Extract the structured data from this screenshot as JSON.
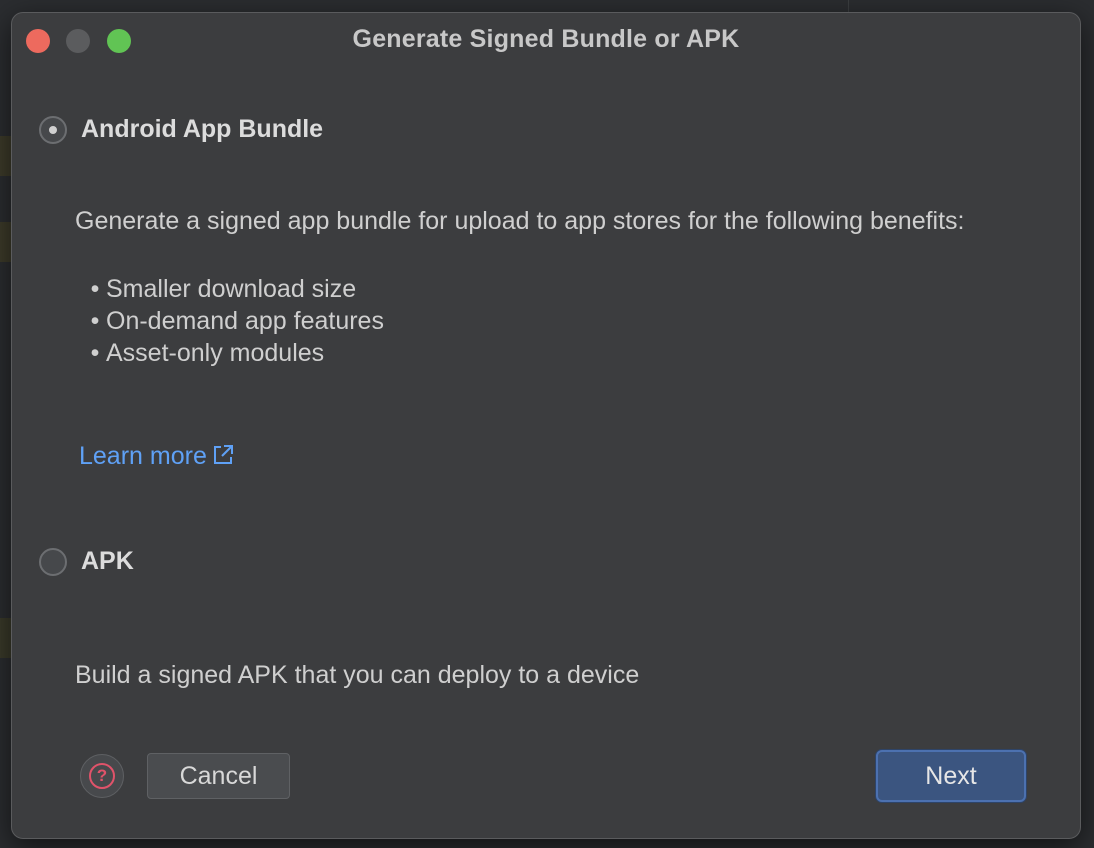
{
  "dialog": {
    "title": "Generate Signed Bundle or APK"
  },
  "options": {
    "bundle": {
      "label": "Android App Bundle",
      "selected": true,
      "description": "Generate a signed app bundle for upload to app stores for the following benefits:",
      "benefits": [
        "Smaller download size",
        "On-demand app features",
        "Asset-only modules"
      ],
      "learn_more": "Learn more"
    },
    "apk": {
      "label": "APK",
      "selected": false,
      "description": "Build a signed APK that you can deploy to a device"
    }
  },
  "footer": {
    "help_icon": "question-circle-icon",
    "help_glyph": "?",
    "cancel_label": "Cancel",
    "next_label": "Next"
  },
  "colors": {
    "link": "#5fa1f6",
    "primary_button": "#3b5580",
    "help_icon": "#e0536a"
  }
}
